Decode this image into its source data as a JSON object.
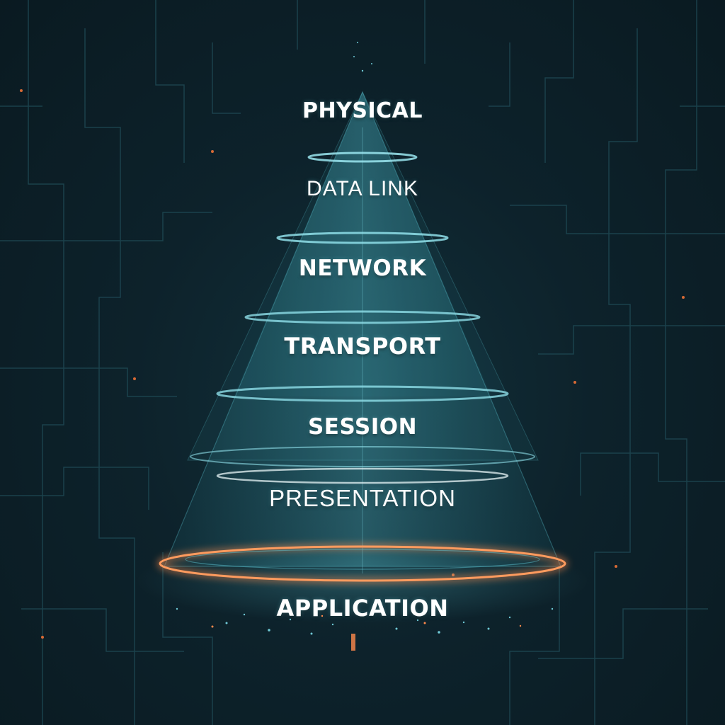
{
  "colors": {
    "background": "#0c1a22",
    "cone": "#3aa3b4",
    "ring": "#7fd9e6",
    "base_ring": "#ff8a4c",
    "text": "#ffffff"
  },
  "layers": [
    {
      "name": "PHYSICAL"
    },
    {
      "name": "DATA LINK"
    },
    {
      "name": "NETWORK"
    },
    {
      "name": "TRANSPORT"
    },
    {
      "name": "SESSION"
    },
    {
      "name": "PRESENTATION"
    },
    {
      "name": "APPLICATION"
    }
  ]
}
